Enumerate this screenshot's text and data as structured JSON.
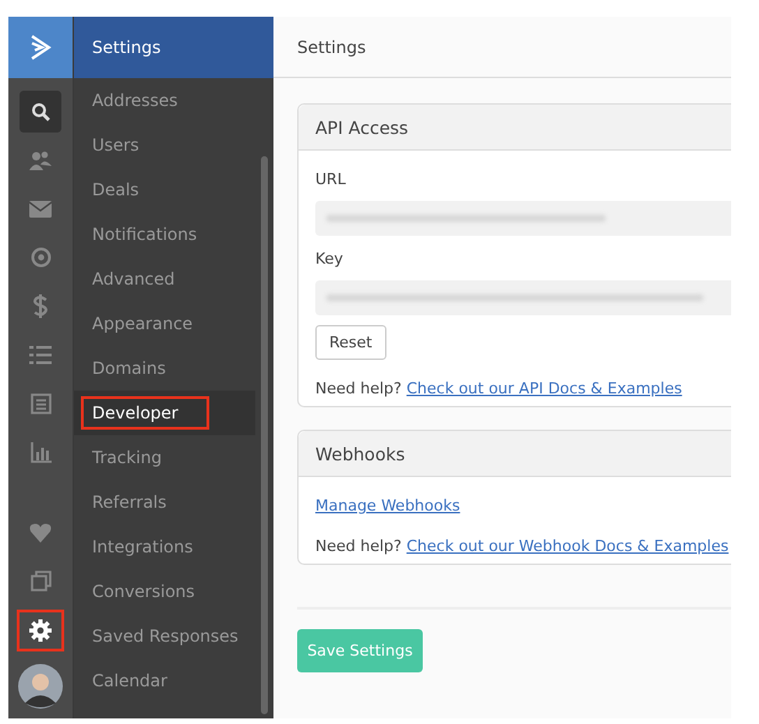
{
  "rail": {
    "items": [
      {
        "kind": "logo",
        "selected": false,
        "highlighted": false
      },
      {
        "kind": "search",
        "selected": true,
        "highlighted": false
      },
      {
        "kind": "contacts",
        "selected": false,
        "highlighted": false
      },
      {
        "kind": "mail",
        "selected": false,
        "highlighted": false
      },
      {
        "kind": "target",
        "selected": false,
        "highlighted": false
      },
      {
        "kind": "dollar",
        "selected": false,
        "highlighted": false
      },
      {
        "kind": "list",
        "selected": false,
        "highlighted": false
      },
      {
        "kind": "document",
        "selected": false,
        "highlighted": false
      },
      {
        "kind": "chart",
        "selected": false,
        "highlighted": false
      },
      {
        "kind": "heart",
        "selected": false,
        "highlighted": false
      },
      {
        "kind": "copies",
        "selected": false,
        "highlighted": false
      },
      {
        "kind": "settings",
        "selected": false,
        "highlighted": true
      },
      {
        "kind": "avatar",
        "selected": false,
        "highlighted": false
      }
    ]
  },
  "nav": {
    "title": "Settings",
    "items": [
      {
        "label": "Addresses",
        "selected": false,
        "highlighted": false
      },
      {
        "label": "Users",
        "selected": false,
        "highlighted": false
      },
      {
        "label": "Deals",
        "selected": false,
        "highlighted": false
      },
      {
        "label": "Notifications",
        "selected": false,
        "highlighted": false
      },
      {
        "label": "Advanced",
        "selected": false,
        "highlighted": false
      },
      {
        "label": "Appearance",
        "selected": false,
        "highlighted": false
      },
      {
        "label": "Domains",
        "selected": false,
        "highlighted": false
      },
      {
        "label": "Developer",
        "selected": true,
        "highlighted": true
      },
      {
        "label": "Tracking",
        "selected": false,
        "highlighted": false
      },
      {
        "label": "Referrals",
        "selected": false,
        "highlighted": false
      },
      {
        "label": "Integrations",
        "selected": false,
        "highlighted": false
      },
      {
        "label": "Conversions",
        "selected": false,
        "highlighted": false
      },
      {
        "label": "Saved Responses",
        "selected": false,
        "highlighted": false
      },
      {
        "label": "Calendar",
        "selected": false,
        "highlighted": false
      }
    ]
  },
  "main": {
    "title": "Settings",
    "panels": [
      {
        "title": "API Access",
        "blocks": [
          {
            "kind": "field",
            "label": "URL"
          },
          {
            "kind": "field",
            "label": "Key"
          },
          {
            "kind": "button",
            "label": "Reset"
          },
          {
            "kind": "help",
            "text": "Need help?",
            "link": "Check out our API Docs & Examples"
          }
        ]
      },
      {
        "title": "Webhooks",
        "blocks": [
          {
            "kind": "link",
            "text": "Manage Webhooks"
          },
          {
            "kind": "help",
            "text": "Need help?",
            "link": "Check out our Webhook Docs & Examples"
          }
        ]
      }
    ],
    "save_button": "Save Settings"
  }
}
